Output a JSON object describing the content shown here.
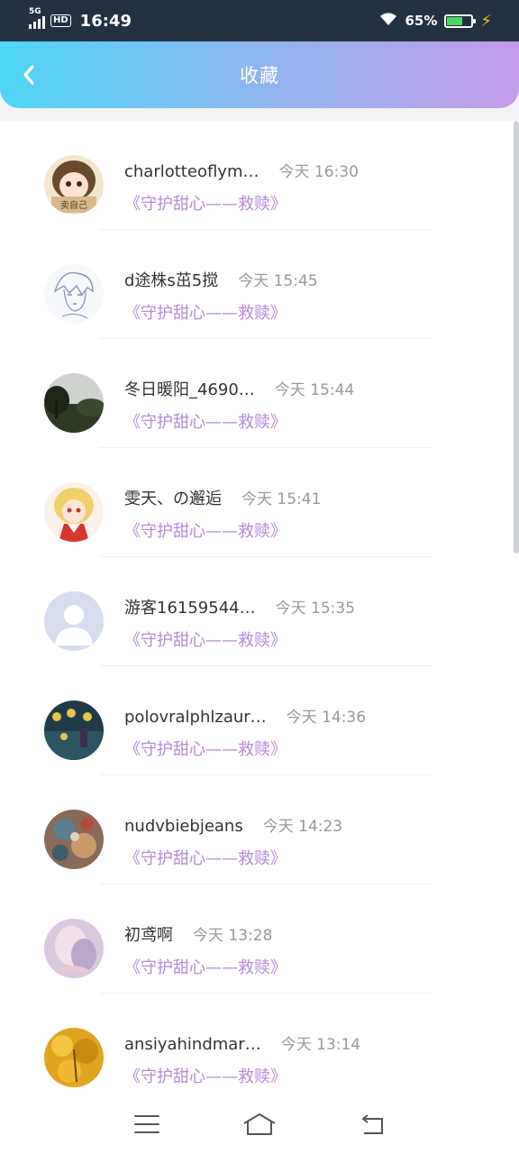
{
  "status_bar": {
    "network": "5G",
    "hd": "HD",
    "time": "16:49",
    "battery_percent": "65%",
    "battery_level": 0.65
  },
  "header": {
    "title": "收藏"
  },
  "items": [
    {
      "name": "charlotteoflym…",
      "time": "今天 16:30",
      "book": "《守护甜心——救赎》",
      "avatar": "anime-girl-avatar"
    },
    {
      "name": "d途株s茁5搅",
      "time": "今天 15:45",
      "book": "《守护甜心——救赎》",
      "avatar": "sketch-boy-avatar"
    },
    {
      "name": "冬日暖阳_4690…",
      "time": "今天 15:44",
      "book": "《守护甜心——救赎》",
      "avatar": "landscape-avatar"
    },
    {
      "name": "雯天、の邂逅",
      "time": "今天 15:41",
      "book": "《守护甜心——救赎》",
      "avatar": "anime-blonde-avatar"
    },
    {
      "name": "游客16159544…",
      "time": "今天 15:35",
      "book": "《守护甜心——救赎》",
      "avatar": "default-user-avatar"
    },
    {
      "name": "polovralphlzaur…",
      "time": "今天 14:36",
      "book": "《守护甜心——救赎》",
      "avatar": "painting-avatar"
    },
    {
      "name": "nudvbiebjeans",
      "time": "今天 14:23",
      "book": "《守护甜心——救赎》",
      "avatar": "collage-avatar"
    },
    {
      "name": "初鸢啊",
      "time": "今天 13:28",
      "book": "《守护甜心——救赎》",
      "avatar": "pastel-girl-avatar"
    },
    {
      "name": "ansiyahindmar…",
      "time": "今天 13:14",
      "book": "《守护甜心——救赎》",
      "avatar": "yellow-leaves-avatar"
    }
  ],
  "colors": {
    "header_gradient": [
      "#4fd6f6",
      "#8eb6ef",
      "#c49be9"
    ],
    "book_title": "#b68ad6",
    "status_bar": "#243142"
  }
}
